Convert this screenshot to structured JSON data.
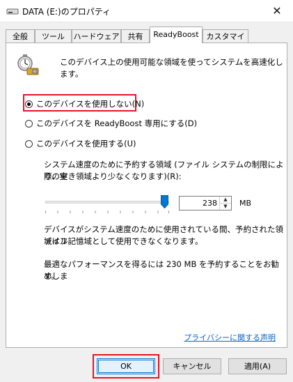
{
  "window": {
    "title": "DATA (E:)のプロパティ",
    "close_label": "✕"
  },
  "tabs": [
    {
      "label": "全般"
    },
    {
      "label": "ツール"
    },
    {
      "label": "ハードウェア"
    },
    {
      "label": "共有"
    },
    {
      "label": "ReadyBoost"
    },
    {
      "label": "カスタマイズ"
    }
  ],
  "active_tab": "ReadyBoost",
  "panel": {
    "intro": "このデバイス上の使用可能な領域を使ってシステムを高速化します。",
    "options": [
      {
        "label": "このデバイスを使用しない(N)",
        "checked": true
      },
      {
        "label": "このデバイスを ReadyBoost 専用にする(D)",
        "checked": false
      },
      {
        "label": "このデバイスを使用する(U)",
        "checked": false
      }
    ],
    "reserve_label_line1": "システム速度のために予約する領域 (ファイル システムの制限により、実",
    "reserve_label_line2": "際の空き領域より少なくなります)(R):",
    "reserve_value": "238",
    "reserve_unit": "MB",
    "note_line1": "デバイスがシステム速度のために使用されている間、予約された領域はフ",
    "note_line2": "ァイル記憶域として使用できなくなります。",
    "recommend_line1": "最適なパフォーマンスを得るには 230 MB を予約することをお勧めしま",
    "recommend_line2": "す。",
    "privacy_link": "プライバシーに関する声明"
  },
  "buttons": {
    "ok": "OK",
    "cancel": "キャンセル",
    "apply": "適用(A)"
  },
  "colors": {
    "highlight": "#e81123",
    "link": "#0066cc",
    "accent": "#0078d7"
  },
  "slider": {
    "fraction": 0.93
  }
}
